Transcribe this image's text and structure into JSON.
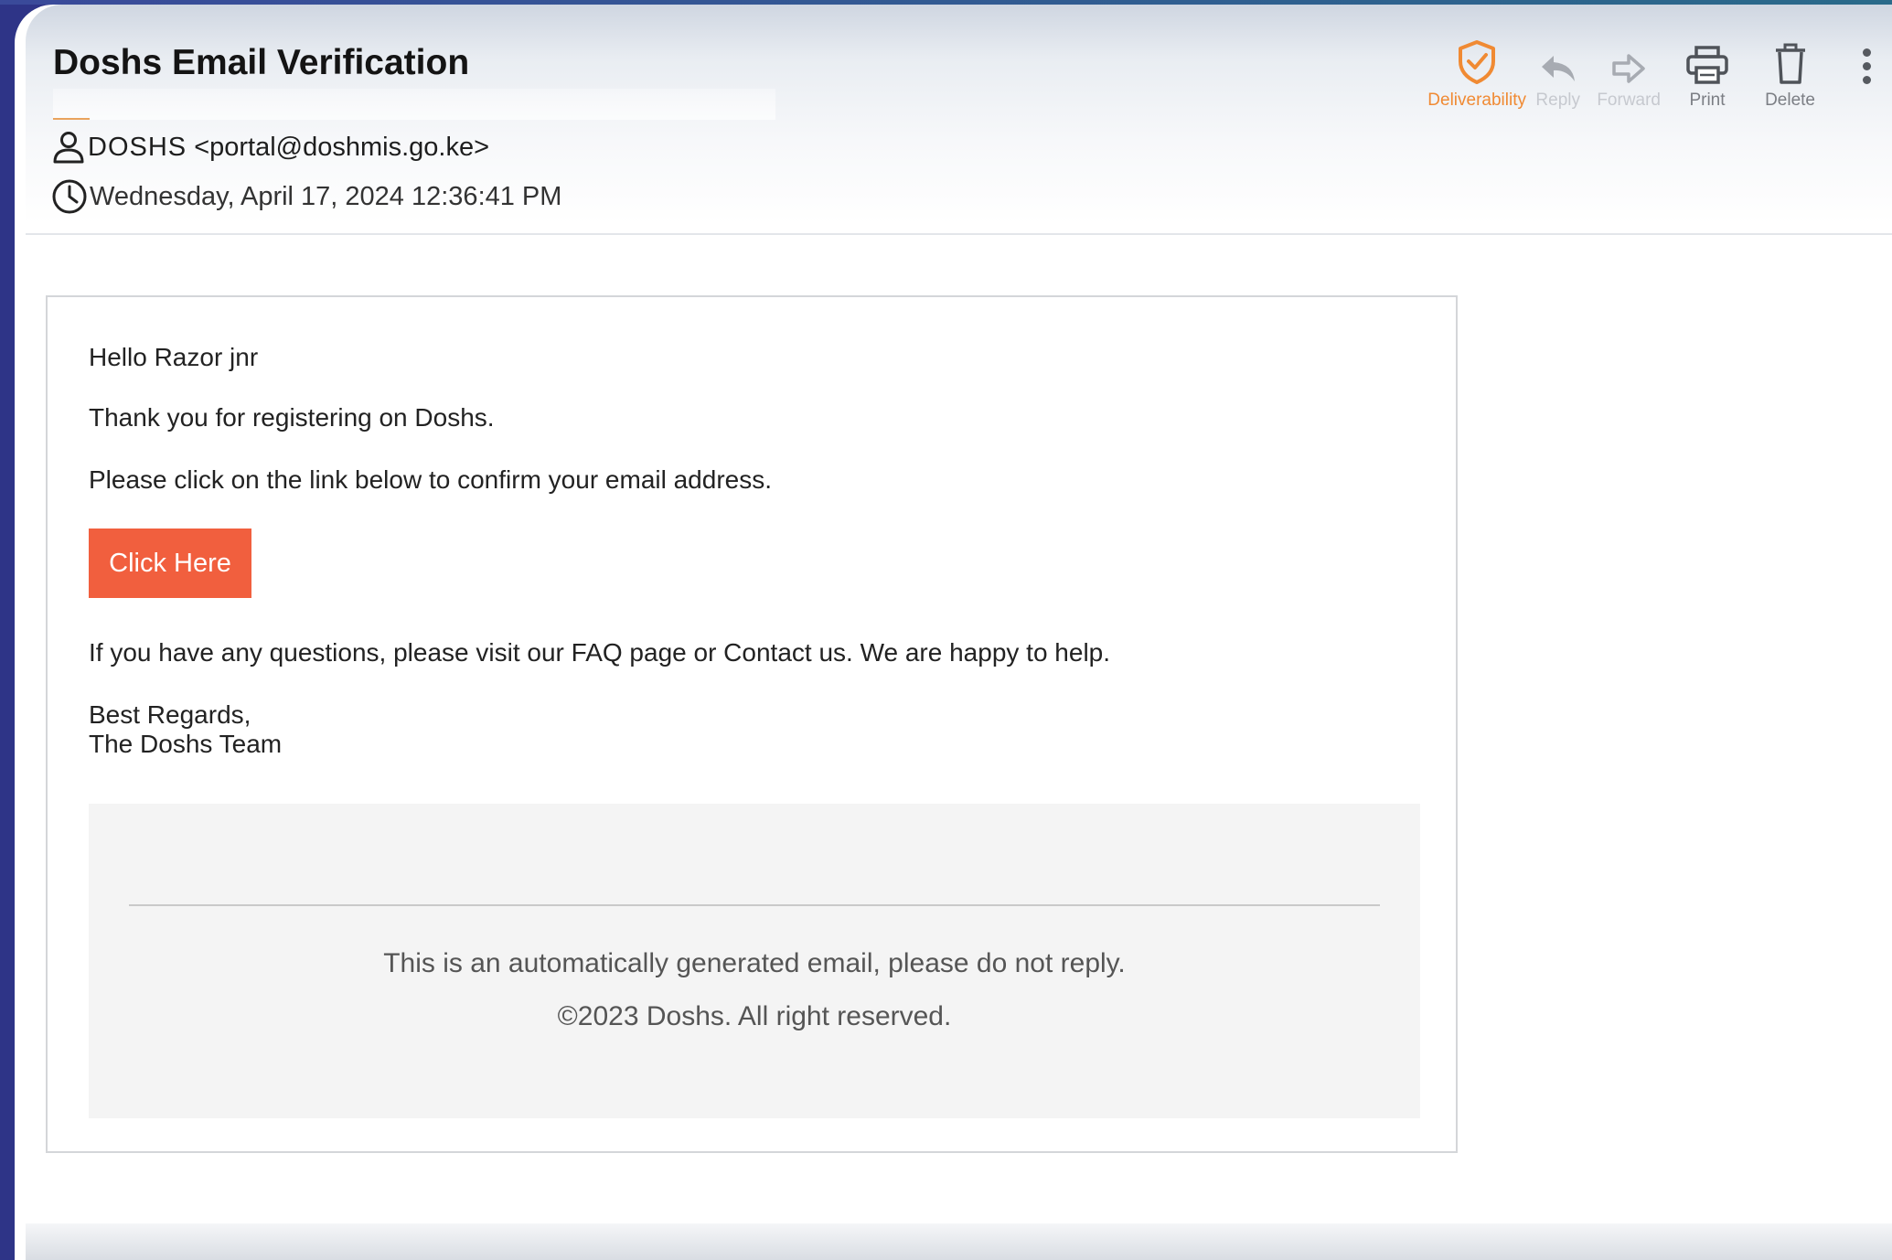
{
  "message": {
    "subject": "Doshs Email Verification",
    "from_name": "DOSHS",
    "from_email": "<portal@doshmis.go.ke>",
    "date": "Wednesday, April 17, 2024 12:36:41 PM"
  },
  "toolbar": {
    "deliverability": "Deliverability",
    "reply": "Reply",
    "forward": "Forward",
    "print": "Print",
    "delete": "Delete"
  },
  "body": {
    "greeting": "Hello Razor jnr",
    "thanks": "Thank you for registering on Doshs.",
    "instruction": "Please click on the link below to confirm your email address.",
    "cta_label": "Click Here",
    "help": "If you have any questions, please visit our FAQ page or Contact us. We are happy to help.",
    "regards": "Best Regards,",
    "signature": "The Doshs Team"
  },
  "footer": {
    "auto_notice": "This is an automatically generated email, please do not reply.",
    "copyright": "©2023 Doshs. All right reserved."
  },
  "icons": {
    "sender": "person-icon",
    "date": "clock-icon",
    "deliverability": "shield-check-icon",
    "reply": "reply-arrow-icon",
    "forward": "forward-arrow-icon",
    "print": "printer-icon",
    "delete": "trash-icon",
    "more": "vertical-dots-icon"
  },
  "colors": {
    "accent_orange": "#f08a33",
    "cta_background": "#f15f3e",
    "frame_blue": "#2e3487"
  }
}
